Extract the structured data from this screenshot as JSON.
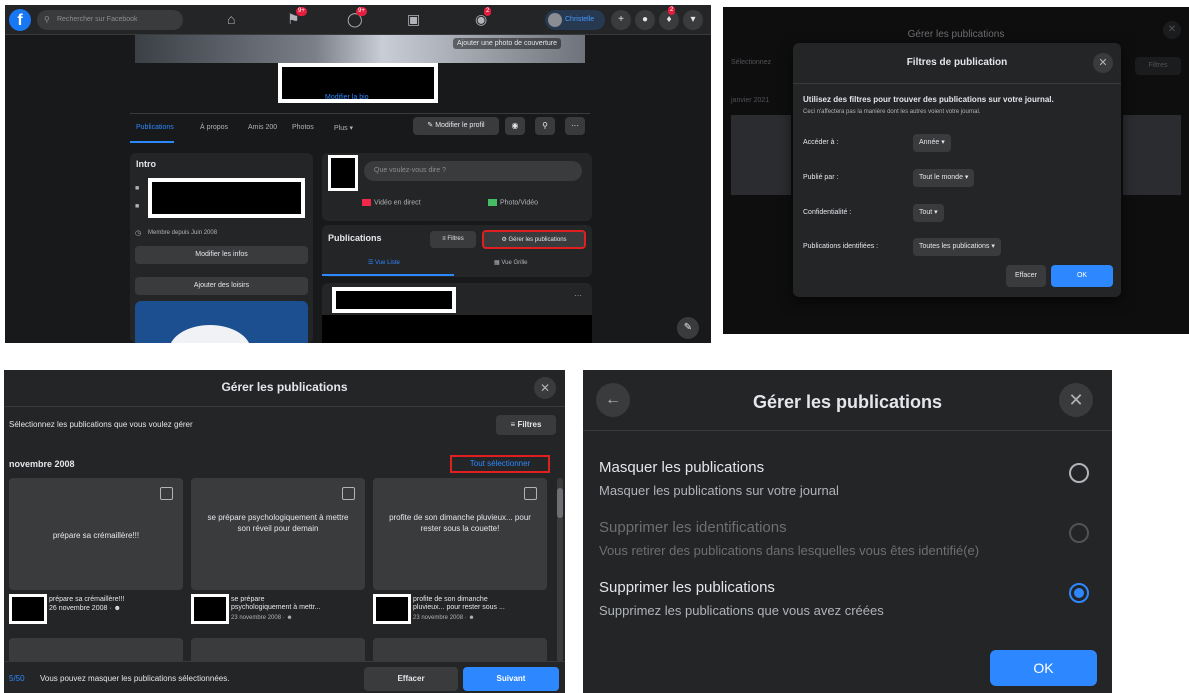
{
  "profile": {
    "search_placeholder": "Rechercher sur Facebook",
    "badges": [
      "9+",
      "9+",
      "2",
      "2"
    ],
    "user_name": "Christelle",
    "cover_button": "Ajouter une photo de couverture",
    "bio_link": "Modifier la bio",
    "tabs": [
      "Publications",
      "À propos",
      "Amis 200",
      "Photos",
      "Plus ▾"
    ],
    "edit_profile": "Modifier le profil",
    "intro_title": "Intro",
    "member_since": "Membre depuis Juin 2008",
    "edit_info": "Modifier les infos",
    "add_hobbies": "Ajouter des loisirs",
    "composer_placeholder": "Que voulez-vous dire ?",
    "live_video": "Vidéo en direct",
    "photo_video": "Photo/Vidéo",
    "publications_title": "Publications",
    "filters": "Filtres",
    "manage_posts": "Gérer les publications",
    "list_view": "Vue Liste",
    "grid_view": "Vue Grille",
    "more": "···"
  },
  "filters_dialog": {
    "bg_title": "Gérer les publications",
    "bg_select": "Sélectionnez",
    "bg_date": "janvier 2021",
    "bg_filters": "Filtres",
    "title": "Filtres de publication",
    "lead": "Utilisez des filtres pour trouver des publications sur votre journal.",
    "sub": "Ceci n'affectera pas la manière dont les autres voient votre journal.",
    "fields": [
      {
        "label": "Accéder à :",
        "value": "Année"
      },
      {
        "label": "Publié par :",
        "value": "Tout le monde"
      },
      {
        "label": "Confidentialité :",
        "value": "Tout"
      },
      {
        "label": "Publications identifiées :",
        "value": "Toutes les publications"
      }
    ],
    "clear": "Effacer",
    "ok": "OK"
  },
  "manage_grid": {
    "title": "Gérer les publications",
    "select_prompt": "Sélectionnez les publications que vous voulez gérer",
    "filters": "Filtres",
    "month": "novembre 2008",
    "select_all": "Tout sélectionner",
    "cards": [
      {
        "text": "prépare sa crémaillère!!!",
        "meta1": "prépare sa crémaillère!!!",
        "meta2": "",
        "date": "26 novembre 2008 · "
      },
      {
        "text": "se prépare psychologiquement à mettre son réveil pour demain",
        "meta1": "se prépare",
        "meta2": "psychologiquement à mettr...",
        "date": "23 novembre 2008 · "
      },
      {
        "text": "profite de son dimanche pluvieux... pour rester sous la couette!",
        "meta1": "profite de son dimanche",
        "meta2": "pluvieux... pour rester sous ...",
        "date": "23 novembre 2008 · "
      }
    ],
    "count": "5/50",
    "hint": "Vous pouvez masquer les publications sélectionnées.",
    "clear": "Effacer",
    "next": "Suivant"
  },
  "manage_options": {
    "title": "Gérer les publications",
    "options": [
      {
        "title": "Masquer les publications",
        "sub": "Masquer les publications sur votre journal",
        "disabled": false,
        "selected": false
      },
      {
        "title": "Supprimer les identifications",
        "sub": "Vous retirer des publications dans lesquelles vous êtes identifié(e)",
        "disabled": true,
        "selected": false
      },
      {
        "title": "Supprimer les publications",
        "sub": "Supprimez les publications que vous avez créées",
        "disabled": false,
        "selected": true
      }
    ],
    "ok": "OK"
  },
  "colors": {
    "accent": "#2d88ff",
    "highlight_box": "#e02020",
    "dark_bg": "#18191a",
    "surface": "#242526"
  }
}
